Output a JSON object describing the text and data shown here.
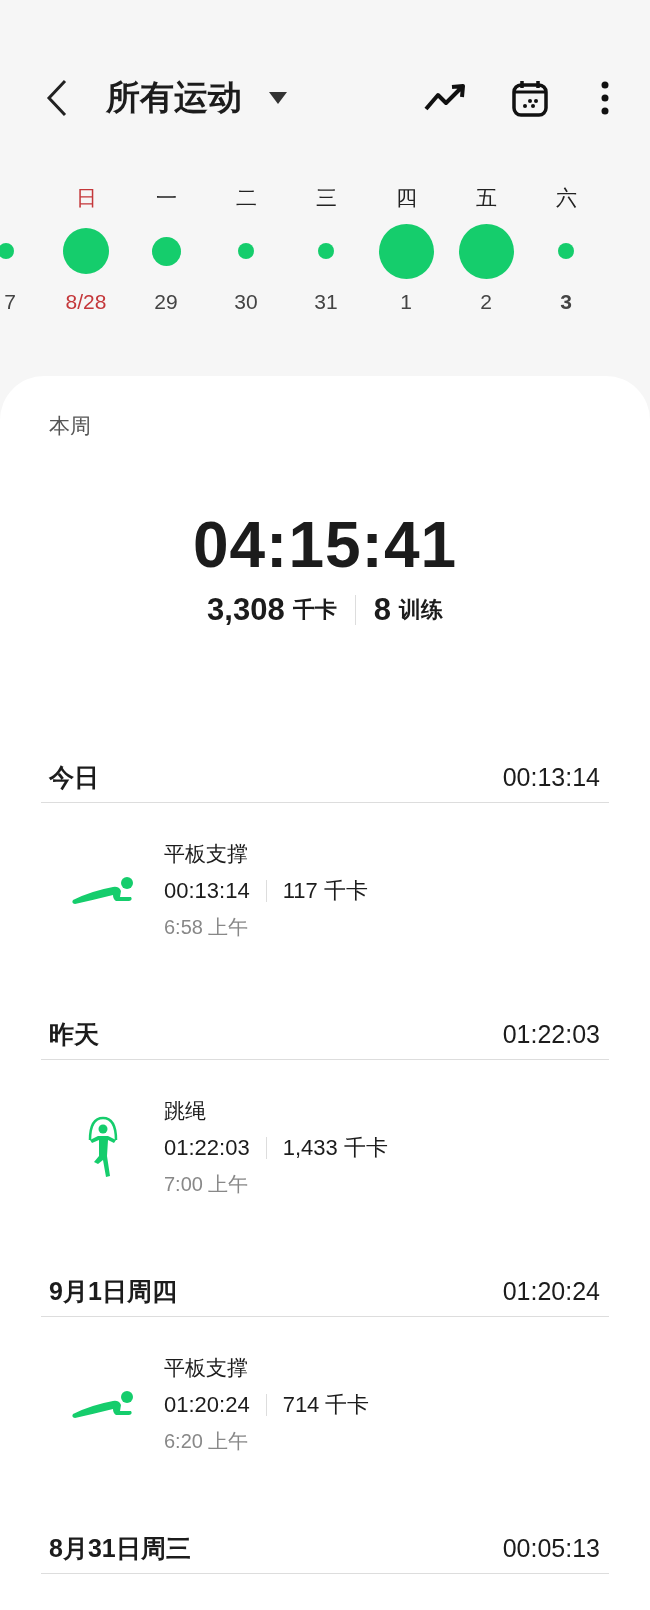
{
  "header": {
    "title": "所有运动"
  },
  "week": [
    {
      "date": "7",
      "kind": "small",
      "sunday": false,
      "today": false
    },
    {
      "weekday": "日",
      "date": "8/28",
      "kind": "large",
      "sunday": true,
      "today": false
    },
    {
      "weekday": "一",
      "date": "29",
      "kind": "medium",
      "sunday": false,
      "today": false
    },
    {
      "weekday": "二",
      "date": "30",
      "kind": "small",
      "sunday": false,
      "today": false
    },
    {
      "weekday": "三",
      "date": "31",
      "kind": "small",
      "sunday": false,
      "today": false
    },
    {
      "weekday": "四",
      "date": "1",
      "kind": "xlarge",
      "sunday": false,
      "today": false
    },
    {
      "weekday": "五",
      "date": "2",
      "kind": "xlarge",
      "sunday": false,
      "today": false
    },
    {
      "weekday": "六",
      "date": "3",
      "kind": "small",
      "sunday": false,
      "today": true
    }
  ],
  "summary": {
    "label": "本周",
    "total_time": "04:15:41",
    "calories": "3,308",
    "calories_unit": "千卡",
    "workouts": "8",
    "workouts_unit": "训练"
  },
  "days": [
    {
      "label": "今日",
      "total": "00:13:14",
      "activities": [
        {
          "kind": "plank",
          "name": "平板支撑",
          "duration": "00:13:14",
          "calories": "117 千卡",
          "time": "6:58 上午"
        }
      ]
    },
    {
      "label": "昨天",
      "total": "01:22:03",
      "activities": [
        {
          "kind": "jump-rope",
          "name": "跳绳",
          "duration": "01:22:03",
          "calories": "1,433 千卡",
          "time": "7:00 上午"
        }
      ]
    },
    {
      "label": "9月1日周四",
      "total": "01:20:24",
      "activities": [
        {
          "kind": "plank",
          "name": "平板支撑",
          "duration": "01:20:24",
          "calories": "714 千卡",
          "time": "6:20 上午"
        }
      ]
    },
    {
      "label": "8月31日周三",
      "total": "00:05:13"
    }
  ]
}
